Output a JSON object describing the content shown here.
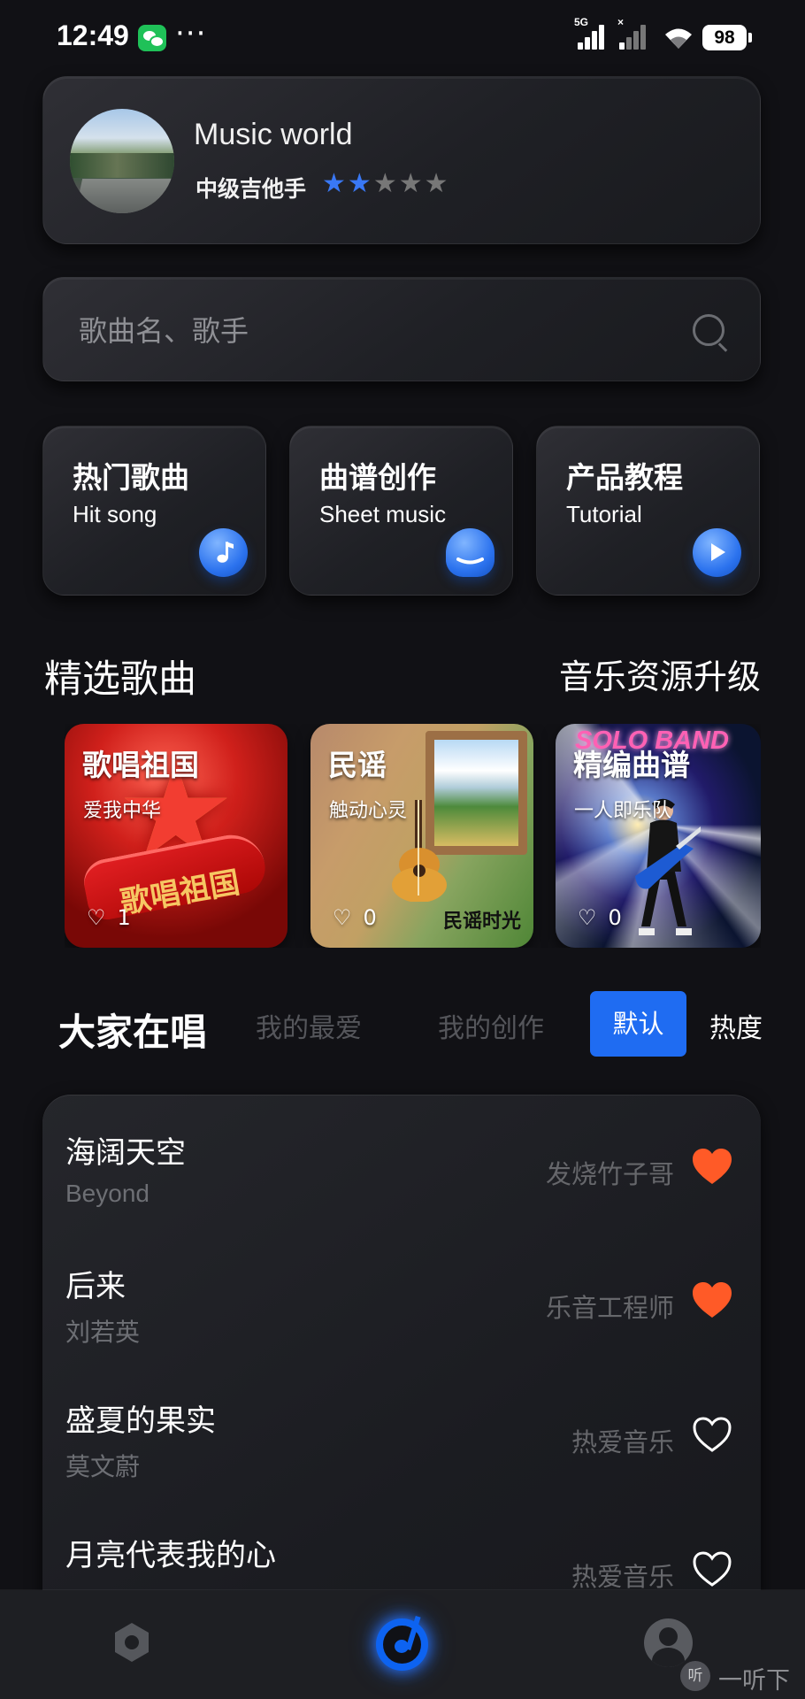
{
  "status_bar": {
    "time": "12:49",
    "battery": "98",
    "network": "5G"
  },
  "profile": {
    "name": "Music world",
    "level": "中级吉他手",
    "stars_filled": 2,
    "stars_total": 5
  },
  "search": {
    "placeholder": "歌曲名、歌手"
  },
  "features": [
    {
      "title": "热门歌曲",
      "subtitle": "Hit song",
      "icon": "music-note-icon"
    },
    {
      "title": "曲谱创作",
      "subtitle": "Sheet music",
      "icon": "hat-icon"
    },
    {
      "title": "产品教程",
      "subtitle": "Tutorial",
      "icon": "play-icon"
    }
  ],
  "selected": {
    "title": "精选歌曲",
    "link": "音乐资源升级",
    "cards": [
      {
        "title": "歌唱祖国",
        "subtitle": "爱我中华",
        "likes": "1",
        "artwork_text": "歌唱祖国"
      },
      {
        "title": "民谣",
        "subtitle": "触动心灵",
        "likes": "0",
        "artwork_text": "民谣时光"
      },
      {
        "title": "精编曲谱",
        "subtitle": "一人即乐队",
        "likes": "0",
        "artwork_text": "SOLO BAND"
      }
    ]
  },
  "community": {
    "title": "大家在唱",
    "tabs": [
      "我的最爱",
      "我的创作"
    ],
    "sort_default": "默认",
    "sort_hot": "热度",
    "songs": [
      {
        "title": "海阔天空",
        "artist": "Beyond",
        "user": "发烧竹子哥",
        "liked": true
      },
      {
        "title": "后来",
        "artist": "刘若英",
        "user": "乐音工程师",
        "liked": true
      },
      {
        "title": "盛夏的果实",
        "artist": "莫文蔚",
        "user": "热爱音乐",
        "liked": false
      },
      {
        "title": "月亮代表我的心",
        "artist": "",
        "user": "热爱音乐",
        "liked": false
      }
    ]
  },
  "watermark": {
    "icon": "听",
    "text": "一听下载"
  },
  "colors": {
    "accent": "#1F6CF2",
    "liked_heart": "#FF5A27"
  }
}
